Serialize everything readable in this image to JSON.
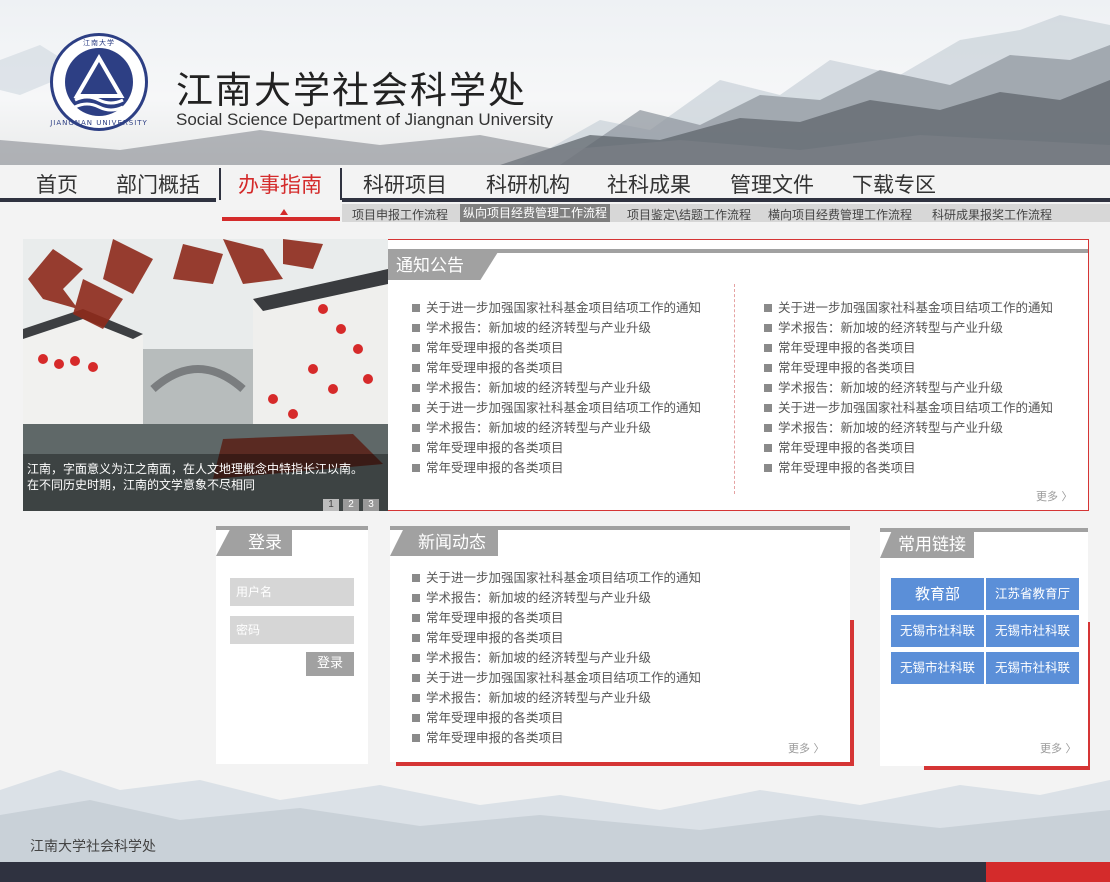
{
  "site": {
    "title": "江南大学社会科学处",
    "subtitle": "Social Science Department of Jiangnan University",
    "logo_text_top": "江南大学",
    "logo_text_bottom": "JIANGNAN UNIVERSITY"
  },
  "nav": {
    "items": [
      {
        "label": "首页"
      },
      {
        "label": "部门概括"
      },
      {
        "label": "办事指南"
      },
      {
        "label": "科研项目"
      },
      {
        "label": "科研机构"
      },
      {
        "label": "社科成果"
      },
      {
        "label": "管理文件"
      },
      {
        "label": "下载专区"
      }
    ],
    "active_index": 2
  },
  "subnav": {
    "items": [
      {
        "label": "项目申报工作流程"
      },
      {
        "label": "纵向项目经费管理工作流程"
      },
      {
        "label": "项目鉴定\\结题工作流程"
      },
      {
        "label": "横向项目经费管理工作流程"
      },
      {
        "label": "科研成果报奖工作流程"
      }
    ],
    "active_index": 1
  },
  "banner": {
    "caption_line1": "江南，字面意义为江之南面，在人文地理概念中特指长江以南。",
    "caption_line2": "在不同历史时期，江南的文学意象不尽相同",
    "dots": [
      "1",
      "2",
      "3"
    ]
  },
  "notice": {
    "title": "通知公告",
    "left": [
      "关于进一步加强国家社科基金项目结项工作的通知",
      "学术报告：新加坡的经济转型与产业升级",
      "常年受理申报的各类项目",
      "常年受理申报的各类项目",
      "学术报告：新加坡的经济转型与产业升级",
      "关于进一步加强国家社科基金项目结项工作的通知",
      "学术报告：新加坡的经济转型与产业升级",
      "常年受理申报的各类项目",
      "常年受理申报的各类项目"
    ],
    "right": [
      "关于进一步加强国家社科基金项目结项工作的通知",
      "学术报告：新加坡的经济转型与产业升级",
      "常年受理申报的各类项目",
      "常年受理申报的各类项目",
      "学术报告：新加坡的经济转型与产业升级",
      "关于进一步加强国家社科基金项目结项工作的通知",
      "学术报告：新加坡的经济转型与产业升级",
      "常年受理申报的各类项目",
      "常年受理申报的各类项目"
    ],
    "more": "更多 〉"
  },
  "login": {
    "title": "登录",
    "username_placeholder": "用户名",
    "password_placeholder": "密码",
    "submit": "登录"
  },
  "news": {
    "title": "新闻动态",
    "items": [
      "关于进一步加强国家社科基金项目结项工作的通知",
      "学术报告：新加坡的经济转型与产业升级",
      "常年受理申报的各类项目",
      "常年受理申报的各类项目",
      "学术报告：新加坡的经济转型与产业升级",
      "关于进一步加强国家社科基金项目结项工作的通知",
      "学术报告：新加坡的经济转型与产业升级",
      "常年受理申报的各类项目",
      "常年受理申报的各类项目"
    ],
    "more": "更多 〉"
  },
  "links": {
    "title": "常用链接",
    "items": [
      {
        "label": "教育部"
      },
      {
        "label": "江苏省教育厅"
      },
      {
        "label": "无锡市社科联"
      },
      {
        "label": "无锡市社科联"
      },
      {
        "label": "无锡市社科联"
      },
      {
        "label": "无锡市社科联"
      }
    ],
    "more": "更多 〉"
  },
  "footer": {
    "text": "江南大学社会科学处"
  },
  "colors": {
    "accent_red": "#d42b2b",
    "nav_dark": "#2f3240",
    "tab_gray": "#a1a1a1",
    "link_blue": "#5b8fd8"
  }
}
